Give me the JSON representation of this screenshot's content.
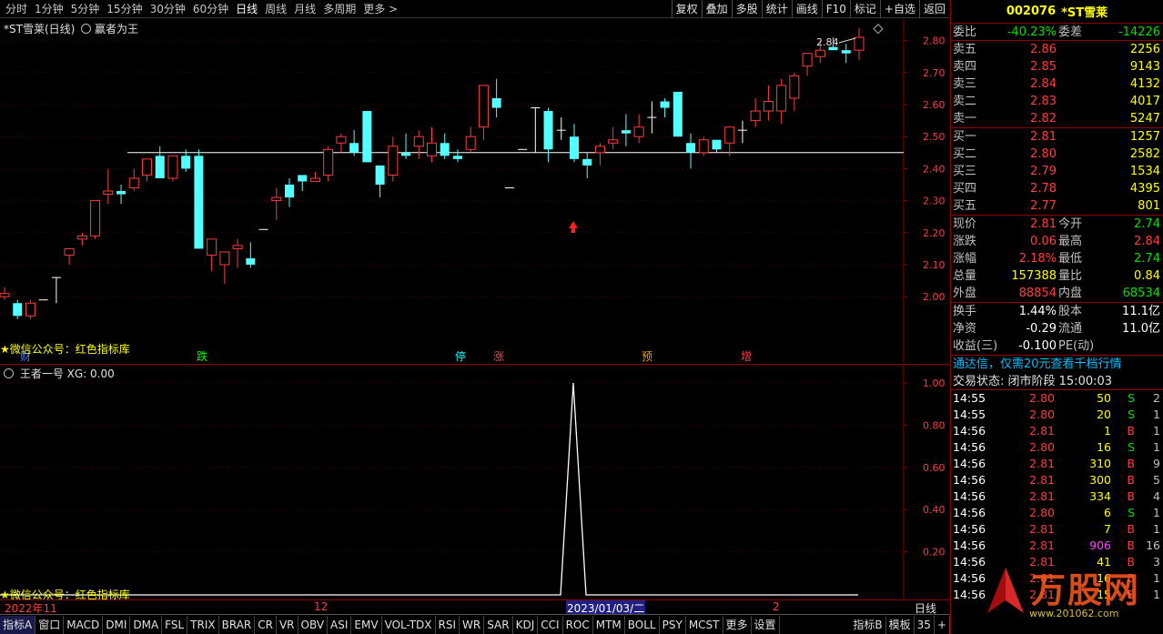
{
  "topbar": {
    "periods": [
      "分时",
      "1分钟",
      "5分钟",
      "15分钟",
      "30分钟",
      "60分钟",
      "日线",
      "周线",
      "月线",
      "多周期",
      "更多 >"
    ],
    "active_period": 6,
    "tools": [
      "复权",
      "叠加",
      "多股",
      "统计",
      "画线",
      "F10",
      "标记",
      "+自选",
      "返回"
    ]
  },
  "main_chart": {
    "title": "*ST雪莱(日线)",
    "indicator_name": "赢者为王",
    "watermark": "★微信公众号：红色指标库",
    "price_labels": [
      "2.80",
      "2.70",
      "2.60",
      "2.50",
      "2.40",
      "2.30",
      "2.20",
      "2.10",
      "2.00"
    ],
    "high_annotation": "2.84",
    "signal_labels": [
      {
        "text": "财",
        "color": "#4080ff"
      },
      {
        "text": "跌",
        "color": "#00ff00"
      },
      {
        "text": "停",
        "color": "#00ffff"
      },
      {
        "text": "涨",
        "color": "#ff4040"
      },
      {
        "text": "预",
        "color": "#ff9900"
      },
      {
        "text": "增",
        "color": "#ff4040"
      }
    ]
  },
  "sub_chart": {
    "title": "王者一号  XG: 0.00",
    "watermark": "★微信公众号：红色指标库",
    "labels": [
      "1.00",
      "0.80",
      "0.60",
      "0.40",
      "0.20"
    ],
    "xg_values": [
      0,
      0,
      0,
      0,
      0,
      0,
      0,
      0,
      0,
      0,
      0,
      0,
      0,
      0,
      0,
      0,
      0,
      0,
      0,
      0,
      0,
      0,
      0,
      0,
      0,
      0,
      0,
      0,
      0,
      0,
      0,
      0,
      0,
      0,
      0,
      0,
      0,
      0,
      0,
      0,
      0,
      1,
      0,
      0,
      0,
      0,
      0,
      0,
      0,
      0,
      0,
      0,
      0,
      0,
      0,
      0,
      0,
      0,
      0,
      0,
      0,
      0
    ]
  },
  "xaxis": {
    "labels": [
      "2022年11",
      "12",
      "2023/01/03/二",
      "2"
    ],
    "period_label": "日线"
  },
  "bottom_tabs": [
    "指标A",
    "窗口",
    "MACD",
    "DMI",
    "DMA",
    "FSL",
    "TRIX",
    "BRAR",
    "CR",
    "VR",
    "OBV",
    "ASI",
    "EMV",
    "VOL-TDX",
    "RSI",
    "WR",
    "SAR",
    "KDJ",
    "CCI",
    "ROC",
    "MTM",
    "BOLL",
    "PSY",
    "MCST",
    "更多",
    "设置"
  ],
  "bottom_right": [
    "指标B",
    "模板",
    "35",
    "+"
  ],
  "chart_data": {
    "type": "candlestick",
    "candles": [
      [
        2.0,
        2.03,
        1.99,
        2.01
      ],
      [
        1.98,
        1.99,
        1.93,
        1.94
      ],
      [
        1.94,
        1.99,
        1.93,
        1.98
      ],
      [
        1.99,
        1.99,
        1.99,
        1.99
      ],
      [
        2.06,
        2.06,
        1.98,
        2.06
      ],
      [
        2.13,
        2.15,
        2.1,
        2.15
      ],
      [
        2.18,
        2.2,
        2.16,
        2.19
      ],
      [
        2.19,
        2.3,
        2.18,
        2.3
      ],
      [
        2.32,
        2.4,
        2.29,
        2.33
      ],
      [
        2.33,
        2.35,
        2.29,
        2.32
      ],
      [
        2.34,
        2.4,
        2.33,
        2.37
      ],
      [
        2.38,
        2.43,
        2.36,
        2.43
      ],
      [
        2.44,
        2.47,
        2.38,
        2.37
      ],
      [
        2.37,
        2.44,
        2.36,
        2.44
      ],
      [
        2.44,
        2.46,
        2.39,
        2.4
      ],
      [
        2.44,
        2.46,
        2.38,
        2.15
      ],
      [
        2.13,
        2.17,
        2.08,
        2.18
      ],
      [
        2.1,
        2.14,
        2.04,
        2.14
      ],
      [
        2.15,
        2.18,
        2.09,
        2.16
      ],
      [
        2.12,
        2.17,
        2.09,
        2.1
      ],
      [
        2.21,
        2.21,
        2.21,
        2.21
      ],
      [
        2.3,
        2.34,
        2.24,
        2.31
      ],
      [
        2.35,
        2.37,
        2.28,
        2.31
      ],
      [
        2.38,
        2.38,
        2.33,
        2.36
      ],
      [
        2.36,
        2.39,
        2.37,
        2.37
      ],
      [
        2.38,
        2.47,
        2.36,
        2.46
      ],
      [
        2.48,
        2.51,
        2.45,
        2.5
      ],
      [
        2.48,
        2.52,
        2.44,
        2.45
      ],
      [
        2.58,
        2.58,
        2.42,
        2.42
      ],
      [
        2.41,
        2.41,
        2.31,
        2.35
      ],
      [
        2.38,
        2.5,
        2.36,
        2.47
      ],
      [
        2.45,
        2.51,
        2.43,
        2.44
      ],
      [
        2.47,
        2.52,
        2.43,
        2.5
      ],
      [
        2.44,
        2.53,
        2.42,
        2.48
      ],
      [
        2.48,
        2.51,
        2.43,
        2.44
      ],
      [
        2.44,
        2.46,
        2.42,
        2.43
      ],
      [
        2.46,
        2.53,
        2.45,
        2.5
      ],
      [
        2.53,
        2.66,
        2.49,
        2.66
      ],
      [
        2.62,
        2.68,
        2.56,
        2.59
      ],
      [
        2.34,
        2.34,
        2.34,
        2.34
      ],
      [
        2.46,
        2.46,
        2.46,
        2.46
      ],
      [
        2.59,
        2.59,
        2.45,
        2.59
      ],
      [
        2.58,
        2.59,
        2.42,
        2.46
      ],
      [
        2.52,
        2.56,
        2.49,
        2.52
      ],
      [
        2.5,
        2.54,
        2.42,
        2.43
      ],
      [
        2.43,
        2.45,
        2.37,
        2.41
      ],
      [
        2.45,
        2.48,
        2.41,
        2.47
      ],
      [
        2.48,
        2.53,
        2.46,
        2.49
      ],
      [
        2.52,
        2.57,
        2.47,
        2.51
      ],
      [
        2.5,
        2.57,
        2.48,
        2.53
      ],
      [
        2.56,
        2.61,
        2.51,
        2.56
      ],
      [
        2.61,
        2.62,
        2.56,
        2.59
      ],
      [
        2.64,
        2.64,
        2.5,
        2.5
      ],
      [
        2.48,
        2.51,
        2.4,
        2.45
      ],
      [
        2.45,
        2.5,
        2.44,
        2.49
      ],
      [
        2.49,
        2.49,
        2.45,
        2.46
      ],
      [
        2.48,
        2.53,
        2.44,
        2.53
      ],
      [
        2.52,
        2.55,
        2.48,
        2.52
      ],
      [
        2.55,
        2.62,
        2.53,
        2.58
      ],
      [
        2.58,
        2.66,
        2.55,
        2.61
      ],
      [
        2.58,
        2.68,
        2.54,
        2.66
      ],
      [
        2.62,
        2.7,
        2.58,
        2.69
      ],
      [
        2.72,
        2.76,
        2.69,
        2.76
      ],
      [
        2.75,
        2.8,
        2.73,
        2.77
      ],
      [
        2.78,
        2.81,
        2.77,
        2.77
      ],
      [
        2.77,
        2.79,
        2.73,
        2.76
      ],
      [
        2.77,
        2.84,
        2.74,
        2.81
      ]
    ],
    "reference_line": 2.45
  },
  "rpanel": {
    "code": "002076",
    "name": "*ST雪莱",
    "webi": {
      "label": "委比",
      "value": "-40.23%",
      "label2": "委差",
      "value2": "-14226"
    },
    "asks": [
      {
        "label": "卖五",
        "price": "2.86",
        "vol": "2256"
      },
      {
        "label": "卖四",
        "price": "2.85",
        "vol": "9143"
      },
      {
        "label": "卖三",
        "price": "2.84",
        "vol": "4132"
      },
      {
        "label": "卖二",
        "price": "2.83",
        "vol": "4017"
      },
      {
        "label": "卖一",
        "price": "2.82",
        "vol": "5247"
      }
    ],
    "bids": [
      {
        "label": "买一",
        "price": "2.81",
        "vol": "1257"
      },
      {
        "label": "买二",
        "price": "2.80",
        "vol": "2582"
      },
      {
        "label": "买三",
        "price": "2.79",
        "vol": "1534"
      },
      {
        "label": "买四",
        "price": "2.78",
        "vol": "4395"
      },
      {
        "label": "买五",
        "price": "2.77",
        "vol": "801"
      }
    ],
    "stats": [
      {
        "l1": "现价",
        "v1": "2.81",
        "c1": "red",
        "l2": "今开",
        "v2": "2.74",
        "c2": "green"
      },
      {
        "l1": "涨跌",
        "v1": "0.06",
        "c1": "red",
        "l2": "最高",
        "v2": "2.84",
        "c2": "red"
      },
      {
        "l1": "涨幅",
        "v1": "2.18%",
        "c1": "red",
        "l2": "最低",
        "v2": "2.74",
        "c2": "green"
      },
      {
        "l1": "总量",
        "v1": "157388",
        "c1": "yellow",
        "l2": "量比",
        "v2": "0.84",
        "c2": "yellow"
      },
      {
        "l1": "外盘",
        "v1": "88854",
        "c1": "red",
        "l2": "内盘",
        "v2": "68534",
        "c2": "green"
      }
    ],
    "stats2": [
      {
        "l1": "换手",
        "v1": "1.44%",
        "l2": "股本",
        "v2": "11.1亿"
      },
      {
        "l1": "净资",
        "v1": "-0.29",
        "l2": "流通",
        "v2": "11.0亿"
      },
      {
        "l1": "收益(三)",
        "v1": "-0.100",
        "l2": "PE(动)",
        "v2": ""
      }
    ],
    "notice": "通达信，仅需20元查看千档行情",
    "trade_status": "交易状态: 闭市阶段 15:00:03",
    "ticks": [
      {
        "t": "14:55",
        "p": "2.80",
        "v": "50",
        "bs": "S",
        "n": "2"
      },
      {
        "t": "14:55",
        "p": "2.80",
        "v": "20",
        "bs": "S",
        "n": "1"
      },
      {
        "t": "14:56",
        "p": "2.81",
        "v": "1",
        "bs": "B",
        "n": "1"
      },
      {
        "t": "14:56",
        "p": "2.80",
        "v": "16",
        "bs": "S",
        "n": "1"
      },
      {
        "t": "14:56",
        "p": "2.81",
        "v": "310",
        "bs": "B",
        "n": "9"
      },
      {
        "t": "14:56",
        "p": "2.81",
        "v": "300",
        "bs": "B",
        "n": "5"
      },
      {
        "t": "14:56",
        "p": "2.81",
        "v": "334",
        "bs": "B",
        "n": "4"
      },
      {
        "t": "14:56",
        "p": "2.80",
        "v": "6",
        "bs": "S",
        "n": "1"
      },
      {
        "t": "14:56",
        "p": "2.81",
        "v": "7",
        "bs": "B",
        "n": "1"
      },
      {
        "t": "14:56",
        "p": "2.81",
        "v": "906",
        "bs": "B",
        "n": "16"
      },
      {
        "t": "14:56",
        "p": "2.81",
        "v": "41",
        "bs": "B",
        "n": "3"
      },
      {
        "t": "14:56",
        "p": "2.81",
        "v": "16",
        "bs": "B",
        "n": "1"
      },
      {
        "t": "14:56",
        "p": "2.81",
        "v": "15",
        "bs": "B",
        "n": "1"
      }
    ],
    "site_watermark": "万股网",
    "site_url": "www.201062.com"
  }
}
